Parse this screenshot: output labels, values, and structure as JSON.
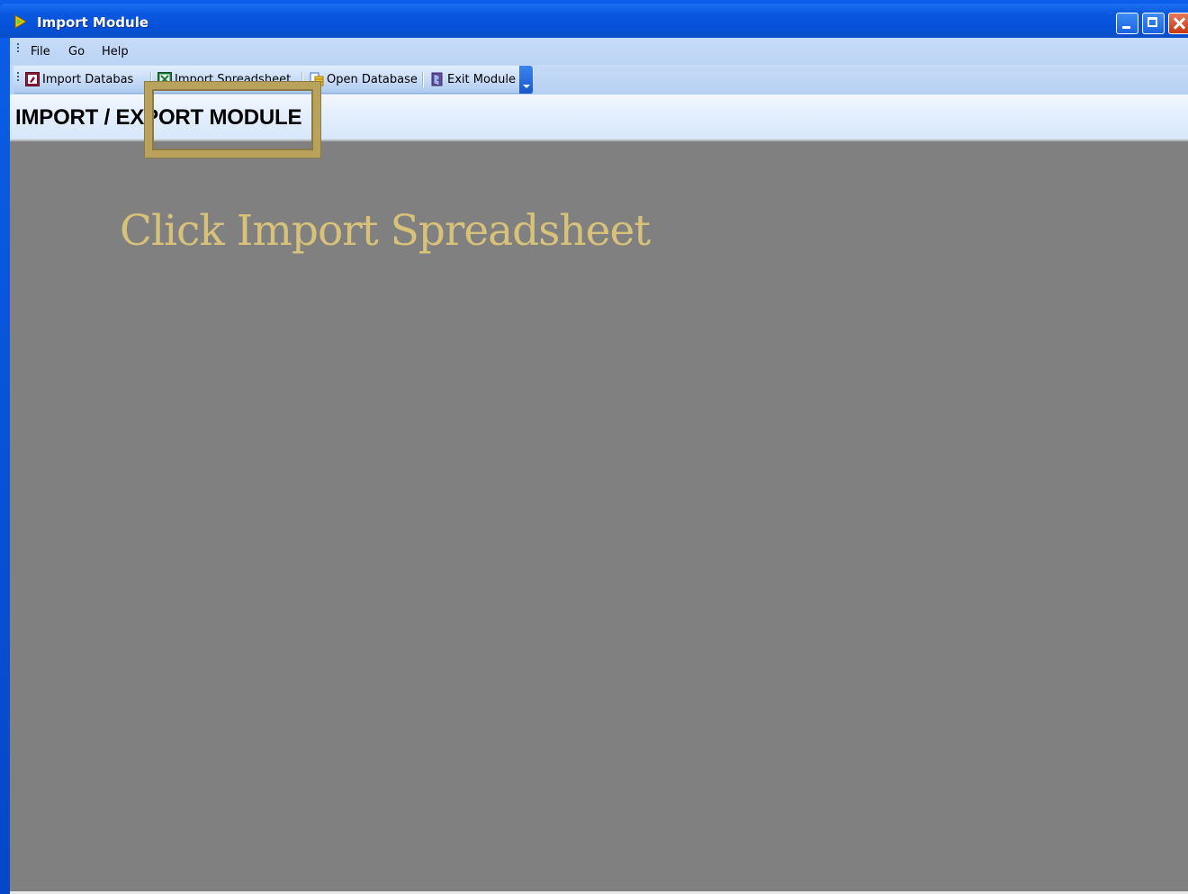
{
  "window": {
    "title": "Import Module"
  },
  "menu": {
    "items": [
      "File",
      "Go",
      "Help"
    ]
  },
  "toolbar": {
    "buttons": [
      {
        "label": "Import Databas",
        "icon": "access-database-icon"
      },
      {
        "label": "Import Spreadsheet",
        "icon": "excel-spreadsheet-icon"
      },
      {
        "label": "Open Database",
        "icon": "open-database-icon"
      },
      {
        "label": "Exit Module",
        "icon": "exit-door-icon"
      }
    ]
  },
  "header": {
    "title": "IMPORT / EXPORT MODULE"
  },
  "overlay": {
    "instruction": "Click Import Spreadsheet",
    "highlight_target": "Import Spreadsheet",
    "highlight_color": "#b8a25c",
    "instruction_color": "#d8c27a"
  },
  "colors": {
    "titlebar": "#0a58e0",
    "client_bg": "#808080",
    "toolbar_bg": "#c4d9f7"
  }
}
